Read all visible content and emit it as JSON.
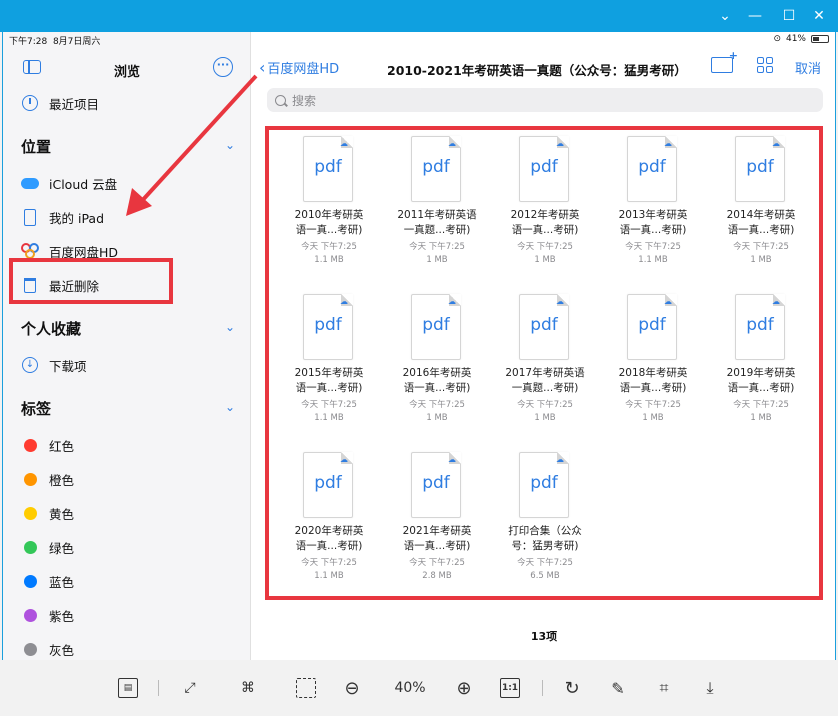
{
  "statusbar": {
    "time": "下午7:28",
    "date": "8月7日周六",
    "battery": "41%"
  },
  "sidebar": {
    "title": "浏览",
    "recent": "最近项目",
    "sections": {
      "locations": "位置",
      "favorites": "个人收藏",
      "tags": "标签"
    },
    "locations": [
      {
        "label": "iCloud 云盘",
        "icon": "icloud-icon"
      },
      {
        "label": "我的 iPad",
        "icon": "ipad-icon"
      },
      {
        "label": "百度网盘HD",
        "icon": "baidu-netdisk-icon"
      },
      {
        "label": "最近删除",
        "icon": "trash-icon"
      }
    ],
    "favorites": [
      {
        "label": "下载项",
        "icon": "download-icon"
      }
    ],
    "tags": [
      {
        "label": "红色",
        "color": "#ff3b30"
      },
      {
        "label": "橙色",
        "color": "#ff9500"
      },
      {
        "label": "黄色",
        "color": "#ffcc00"
      },
      {
        "label": "绿色",
        "color": "#34c759"
      },
      {
        "label": "蓝色",
        "color": "#007aff"
      },
      {
        "label": "紫色",
        "color": "#af52de"
      },
      {
        "label": "灰色",
        "color": "#8e8e93"
      }
    ]
  },
  "nav": {
    "back": "百度网盘HD",
    "title": "2010-2021年考研英语一真题（公众号：猛男考研）",
    "cancel": "取消"
  },
  "search": {
    "placeholder": "搜索"
  },
  "files": [
    {
      "icon_label": "pdf",
      "name": [
        "2010年考研英",
        "语一真...考研)"
      ],
      "date": "今天 下午7:25",
      "size": "1.1 MB"
    },
    {
      "icon_label": "pdf",
      "name": [
        "2011年考研英语",
        "一真题...考研)"
      ],
      "date": "今天 下午7:25",
      "size": "1 MB"
    },
    {
      "icon_label": "pdf",
      "name": [
        "2012年考研英",
        "语一真...考研)"
      ],
      "date": "今天 下午7:25",
      "size": "1 MB"
    },
    {
      "icon_label": "pdf",
      "name": [
        "2013年考研英",
        "语一真...考研)"
      ],
      "date": "今天 下午7:25",
      "size": "1.1 MB"
    },
    {
      "icon_label": "pdf",
      "name": [
        "2014年考研英",
        "语一真...考研)"
      ],
      "date": "今天 下午7:25",
      "size": "1 MB"
    },
    {
      "icon_label": "pdf",
      "name": [
        "2015年考研英",
        "语一真...考研)"
      ],
      "date": "今天 下午7:25",
      "size": "1.1 MB"
    },
    {
      "icon_label": "pdf",
      "name": [
        "2016年考研英",
        "语一真...考研)"
      ],
      "date": "今天 下午7:25",
      "size": "1 MB"
    },
    {
      "icon_label": "pdf",
      "name": [
        "2017年考研英语",
        "一真题...考研)"
      ],
      "date": "今天 下午7:25",
      "size": "1 MB"
    },
    {
      "icon_label": "pdf",
      "name": [
        "2018年考研英",
        "语一真...考研)"
      ],
      "date": "今天 下午7:25",
      "size": "1 MB"
    },
    {
      "icon_label": "pdf",
      "name": [
        "2019年考研英",
        "语一真...考研)"
      ],
      "date": "今天 下午7:25",
      "size": "1 MB"
    },
    {
      "icon_label": "pdf",
      "name": [
        "2020年考研英",
        "语一真...考研)"
      ],
      "date": "今天 下午7:25",
      "size": "1.1 MB"
    },
    {
      "icon_label": "pdf",
      "name": [
        "2021年考研英",
        "语一真...考研)"
      ],
      "date": "今天 下午7:25",
      "size": "2.8 MB"
    },
    {
      "icon_label": "pdf",
      "name": [
        "打印合集（公众",
        "号：猛男考研)"
      ],
      "date": "今天 下午7:25",
      "size": "6.5 MB"
    }
  ],
  "count": "13项",
  "toolbar": {
    "zoom": "40%",
    "actual_size": "1:1"
  },
  "accent_color": "#2f7de1",
  "annotation_color": "#e8363f"
}
